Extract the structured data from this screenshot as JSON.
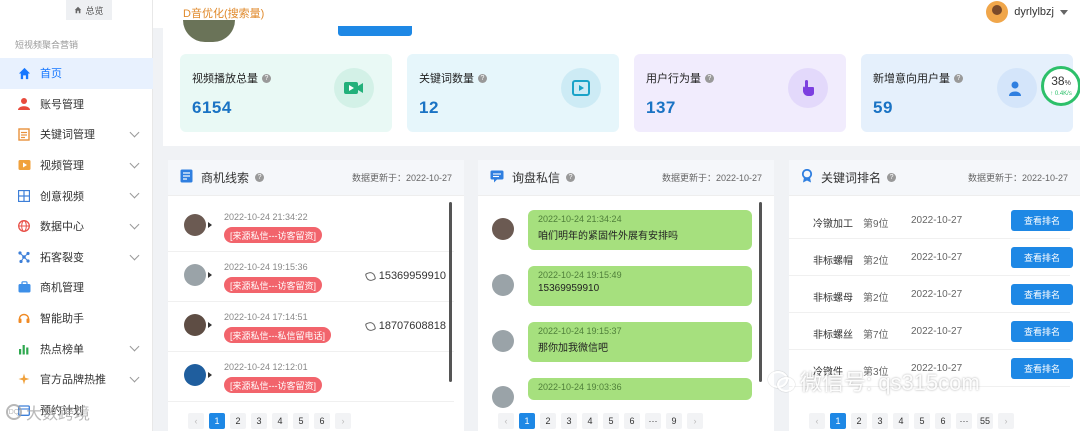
{
  "header": {
    "home_tab": "总览",
    "page_title": "D音优化(搜索量)",
    "username": "dyrlylbzj"
  },
  "sidebar": {
    "caption": "短视频聚合营销",
    "items": [
      {
        "label": "首页",
        "icon": "home-icon",
        "active": true,
        "expandable": false
      },
      {
        "label": "账号管理",
        "icon": "user-icon",
        "active": false,
        "expandable": false
      },
      {
        "label": "关键词管理",
        "icon": "list-icon",
        "active": false,
        "expandable": true
      },
      {
        "label": "视频管理",
        "icon": "video-icon",
        "active": false,
        "expandable": true
      },
      {
        "label": "创意视频",
        "icon": "grid-icon",
        "active": false,
        "expandable": true
      },
      {
        "label": "数据中心",
        "icon": "globe-icon",
        "active": false,
        "expandable": true
      },
      {
        "label": "拓客裂变",
        "icon": "share-icon",
        "active": false,
        "expandable": true
      },
      {
        "label": "商机管理",
        "icon": "briefcase-icon",
        "active": false,
        "expandable": false
      },
      {
        "label": "智能助手",
        "icon": "headset-icon",
        "active": false,
        "expandable": false
      },
      {
        "label": "热点榜单",
        "icon": "bar-chart-icon",
        "active": false,
        "expandable": true
      },
      {
        "label": "官方品牌热推",
        "icon": "sparkle-icon",
        "active": false,
        "expandable": true
      },
      {
        "label": "预约计划",
        "icon": "calendar-icon",
        "active": false,
        "expandable": false
      }
    ]
  },
  "stats": {
    "cards": [
      {
        "title": "视频播放总量",
        "value": "6154",
        "icon": "play-video-icon"
      },
      {
        "title": "关键词数量",
        "value": "12",
        "icon": "play-box-icon"
      },
      {
        "title": "用户行为量",
        "value": "137",
        "icon": "pointer-hand-icon"
      },
      {
        "title": "新增意向用户量",
        "value": "59",
        "icon": "users-icon"
      }
    ],
    "progress": {
      "percent": "38",
      "unit": "%",
      "speed": "↑ 0.4K/s"
    }
  },
  "leads": {
    "title": "商机线索",
    "updated": "数据更新于：2022-10-27",
    "rows": [
      {
        "time": "2022-10-24 21:34:22",
        "tag": "[来源私信---访客留资]",
        "phone": ""
      },
      {
        "time": "2022-10-24 19:15:36",
        "tag": "[来源私信---访客留资]",
        "phone": "15369959910"
      },
      {
        "time": "2022-10-24 17:14:51",
        "tag": "[来源私信---私信留电话]",
        "phone": "18707608818"
      },
      {
        "time": "2022-10-24 12:12:01",
        "tag": "[来源私信---访客留资]",
        "phone": ""
      }
    ],
    "pages": [
      "1",
      "2",
      "3",
      "4",
      "5",
      "6"
    ]
  },
  "messages": {
    "title": "询盘私信",
    "updated": "数据更新于：2022-10-27",
    "rows": [
      {
        "time": "2022-10-24 21:34:24",
        "text": "咱们明年的紧固件外展有安排吗"
      },
      {
        "time": "2022-10-24 19:15:49",
        "text": "15369959910"
      },
      {
        "time": "2022-10-24 19:15:37",
        "text": "那你加我微信吧"
      },
      {
        "time": "2022-10-24 19:03:36",
        "text": ""
      }
    ],
    "pages": [
      "1",
      "2",
      "3",
      "4",
      "5",
      "6",
      "···",
      "9"
    ]
  },
  "keywords": {
    "title": "关键词排名",
    "updated": "数据更新于：2022-10-27",
    "button_label": "查看排名",
    "rows": [
      {
        "keyword": "冷镦加工",
        "rank": "第9位",
        "date": "2022-10-27"
      },
      {
        "keyword": "非标螺帽",
        "rank": "第2位",
        "date": "2022-10-27"
      },
      {
        "keyword": "非标螺母",
        "rank": "第2位",
        "date": "2022-10-27"
      },
      {
        "keyword": "非标螺丝",
        "rank": "第7位",
        "date": "2022-10-27"
      },
      {
        "keyword": "冷镦件",
        "rank": "第3位",
        "date": "2022-10-27"
      }
    ],
    "pages": [
      "1",
      "2",
      "3",
      "4",
      "5",
      "6",
      "···",
      "55"
    ]
  },
  "watermarks": {
    "left": "大数跨境",
    "left_logo": "DQ",
    "right": "微信号: qs315com"
  },
  "colors": {
    "accent": "#1e88e5",
    "tag_red": "#f2646c",
    "bubble_green": "#a6e07e",
    "active_menu_bg": "#e8f1fe",
    "card1": "#e9f9f5",
    "card2": "#e6f6fb",
    "card3": "#f1ecfd",
    "card4": "#e5f0fc"
  }
}
